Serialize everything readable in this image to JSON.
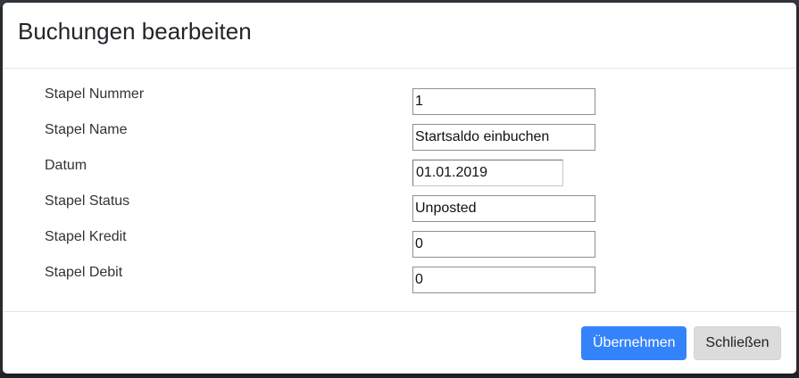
{
  "modal": {
    "title": "Buchungen bearbeiten"
  },
  "form": {
    "fields": [
      {
        "label": "Stapel Nummer",
        "value": "1"
      },
      {
        "label": "Stapel Name",
        "value": "Startsaldo einbuchen"
      },
      {
        "label": "Datum",
        "value": "01.01.2019"
      },
      {
        "label": "Stapel Status",
        "value": "Unposted"
      },
      {
        "label": "Stapel Kredit",
        "value": "0"
      },
      {
        "label": "Stapel Debit",
        "value": "0"
      }
    ]
  },
  "footer": {
    "apply_label": "Übernehmen",
    "close_label": "Schließen"
  },
  "colors": {
    "primary": "#3483fb",
    "secondary": "#dcdcdc"
  }
}
